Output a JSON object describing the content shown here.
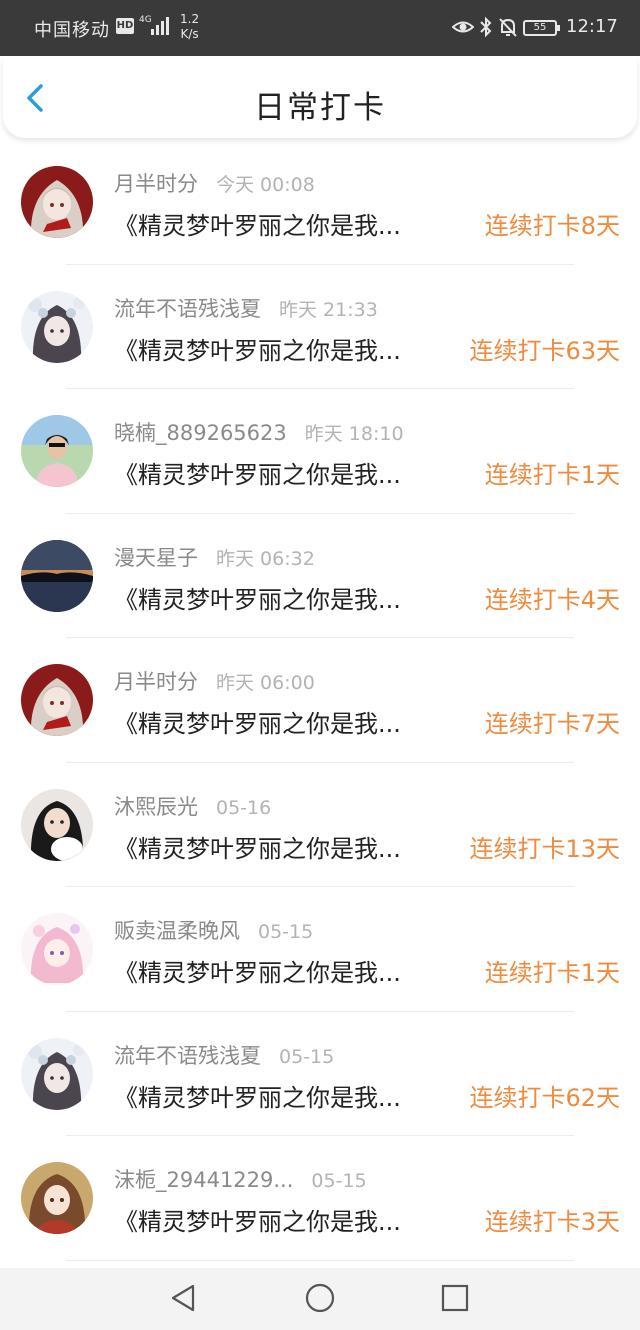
{
  "status_bar": {
    "carrier": "中国移动",
    "hd": "HD",
    "network": "4G",
    "speed_value": "1.2",
    "speed_unit": "K/s",
    "battery": "55",
    "time": "12:17"
  },
  "header": {
    "title": "日常打卡"
  },
  "check_ins": [
    {
      "name": "月半时分",
      "time": "今天 00:08",
      "content": "《精灵梦叶罗丽之你是我...",
      "streak": "连续打卡8天",
      "avatar": "anime-girl-red"
    },
    {
      "name": "流年不语残浅夏",
      "time": "昨天 21:33",
      "content": "《精灵梦叶罗丽之你是我...",
      "streak": "连续打卡63天",
      "avatar": "anime-girl-flowers"
    },
    {
      "name": "晓楠_889265623",
      "time": "昨天 18:10",
      "content": "《精灵梦叶罗丽之你是我...",
      "streak": "连续打卡1天",
      "avatar": "photo-woman-pink"
    },
    {
      "name": "漫天星子",
      "time": "昨天 06:32",
      "content": "《精灵梦叶罗丽之你是我...",
      "streak": "连续打卡4天",
      "avatar": "sunset-lake"
    },
    {
      "name": "月半时分",
      "time": "昨天 06:00",
      "content": "《精灵梦叶罗丽之你是我...",
      "streak": "连续打卡7天",
      "avatar": "anime-girl-red"
    },
    {
      "name": "沐熙辰光",
      "time": "05-16",
      "content": "《精灵梦叶罗丽之你是我...",
      "streak": "连续打卡13天",
      "avatar": "photo-girl-plush"
    },
    {
      "name": "贩卖温柔晚风",
      "time": "05-15",
      "content": "《精灵梦叶罗丽之你是我...",
      "streak": "连续打卡1天",
      "avatar": "anime-girl-pink-hair"
    },
    {
      "name": "流年不语残浅夏",
      "time": "05-15",
      "content": "《精灵梦叶罗丽之你是我...",
      "streak": "连续打卡62天",
      "avatar": "anime-girl-flowers"
    },
    {
      "name": "沫栀_29441229...",
      "time": "05-15",
      "content": "《精灵梦叶罗丽之你是我...",
      "streak": "连续打卡3天",
      "avatar": "anime-girl-brown-hair"
    }
  ],
  "colors": {
    "accent_blue": "#2d9cdb",
    "streak_orange": "#ef8a3e",
    "status_bar_bg": "#3a3a3a"
  }
}
